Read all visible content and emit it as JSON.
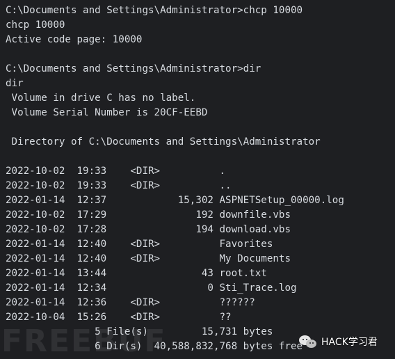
{
  "terminal": {
    "lines": [
      "C:\\Documents and Settings\\Administrator>chcp 10000",
      "chcp 10000",
      "Active code page: 10000",
      "",
      "C:\\Documents and Settings\\Administrator>dir",
      "dir",
      " Volume in drive C has no label.",
      " Volume Serial Number is 20CF-EEBD",
      "",
      " Directory of C:\\Documents and Settings\\Administrator",
      "",
      "2022-10-02  19:33    <DIR>          .",
      "2022-10-02  19:33    <DIR>          ..",
      "2022-01-14  12:37            15,302 ASPNETSetup_00000.log",
      "2022-10-02  17:29               192 downfile.vbs",
      "2022-10-02  17:28               194 download.vbs",
      "2022-01-14  12:40    <DIR>          Favorites",
      "2022-01-14  12:40    <DIR>          My Documents",
      "2022-01-14  13:44                43 root.txt",
      "2022-01-14  12:34                 0 Sti_Trace.log",
      "2022-01-14  12:36    <DIR>          ??????",
      "2022-10-04  15:26    <DIR>          ??",
      "               5 File(s)         15,731 bytes",
      "               6 Dir(s)  40,588,832,768 bytes free"
    ]
  },
  "watermark": {
    "left_text": "FREEBUF",
    "right_text": "HACK学习君",
    "icon": "wechat-icon"
  },
  "colors": {
    "background": "#1e1f22",
    "text": "#d7dbe0"
  }
}
